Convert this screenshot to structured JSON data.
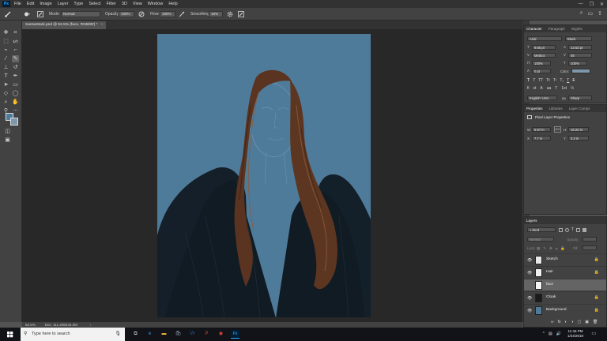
{
  "menubar": {
    "logo": "Ps",
    "items": [
      "File",
      "Edit",
      "Image",
      "Layer",
      "Type",
      "Select",
      "Filter",
      "3D",
      "View",
      "Window",
      "Help"
    ],
    "window_controls": [
      "—",
      "❐",
      "✕"
    ]
  },
  "options": {
    "mode_label": "Mode:",
    "mode_value": "Normal",
    "opacity_label": "Opacity:",
    "opacity_value": "100%",
    "flow_label": "Flow:",
    "flow_value": "100%",
    "smoothing_label": "Smoothing:",
    "smoothing_value": "10%",
    "right_icons": [
      "⌕",
      "▭",
      "⇪"
    ]
  },
  "document": {
    "tab_title": "SansaStark.psd @ 52.5% (face, RGB/8#) *",
    "tab_close": "×"
  },
  "status": {
    "zoom": "52.5%",
    "doc_info": "Doc: 111.2M/244.0M",
    "arrow": "›"
  },
  "character": {
    "tabs": [
      "Character",
      "Paragraph",
      "Glyphs"
    ],
    "font_family": "Arial",
    "font_style": "Black",
    "font_size": "9.65 pt",
    "leading": "12.53 pt",
    "kerning": "Metrics",
    "tracking": "46",
    "vscale": "100%",
    "hscale": "100%",
    "baseline": "0 pt",
    "color_label": "Color:",
    "language": "English: USA",
    "antialias": "Sharp",
    "aa_prefix": "aa",
    "type_buttons": [
      "T",
      "T",
      "TT",
      "Tt",
      "T¹",
      "T₁",
      "T",
      "T"
    ]
  },
  "properties": {
    "tabs": [
      "Properties",
      "Libraries",
      "Layer Comps"
    ],
    "title": "Pixel Layer Properties",
    "w_label": "W:",
    "w_value": "5.97 in",
    "h_label": "H:",
    "h_value": "16.22 in",
    "x_label": "X:",
    "x_value": "7.7 in",
    "y_label": "Y:",
    "y_value": "3.2 in",
    "link": "GO"
  },
  "layers": {
    "tab": "Layers",
    "kind_label": "Kind",
    "blend_mode": "Normal",
    "opacity_label": "Opacity:",
    "fill_label": "Fill:",
    "lock_label": "Lock:",
    "items": [
      {
        "name": "Sketch",
        "visible": true,
        "selected": false,
        "thumb": "#e8e8e8"
      },
      {
        "name": "Hair",
        "visible": true,
        "selected": false,
        "thumb": "#f0f0f0"
      },
      {
        "name": "face",
        "visible": false,
        "selected": true,
        "thumb": "#f4f4f4"
      },
      {
        "name": "Cloak",
        "visible": true,
        "selected": false,
        "thumb": "#1b1b1b"
      },
      {
        "name": "Background",
        "visible": true,
        "selected": false,
        "thumb": "#4f7b9a"
      }
    ],
    "footer_icons": [
      "∞",
      "fx",
      "◐",
      "◑",
      "▢",
      "▣",
      "🗑"
    ]
  },
  "taskbar": {
    "search_placeholder": "Type here to search",
    "time": "11:46 PM",
    "date": "1/24/2018",
    "apps": [
      {
        "name": "task-view",
        "glyph": "⧉",
        "color": "#cfd8e3"
      },
      {
        "name": "edge",
        "glyph": "e",
        "color": "#3b8ed8"
      },
      {
        "name": "file-explorer",
        "glyph": "▬",
        "color": "#f6c142"
      },
      {
        "name": "store",
        "glyph": "🛍",
        "color": "#9aa7b6"
      },
      {
        "name": "word",
        "glyph": "W",
        "color": "#2b579a"
      },
      {
        "name": "powerpoint",
        "glyph": "P",
        "color": "#d24726"
      },
      {
        "name": "chrome",
        "glyph": "◉",
        "color": "#e8453c"
      },
      {
        "name": "photoshop",
        "glyph": "Ps",
        "color": "#31a8ff"
      }
    ]
  },
  "colors": {
    "canvas_bg": "#4f7b9a",
    "hair": "#5a3420",
    "cloak": "#15212b",
    "foreground_swatch": "#4f7b9a",
    "background_swatch": "#7e97aa"
  }
}
